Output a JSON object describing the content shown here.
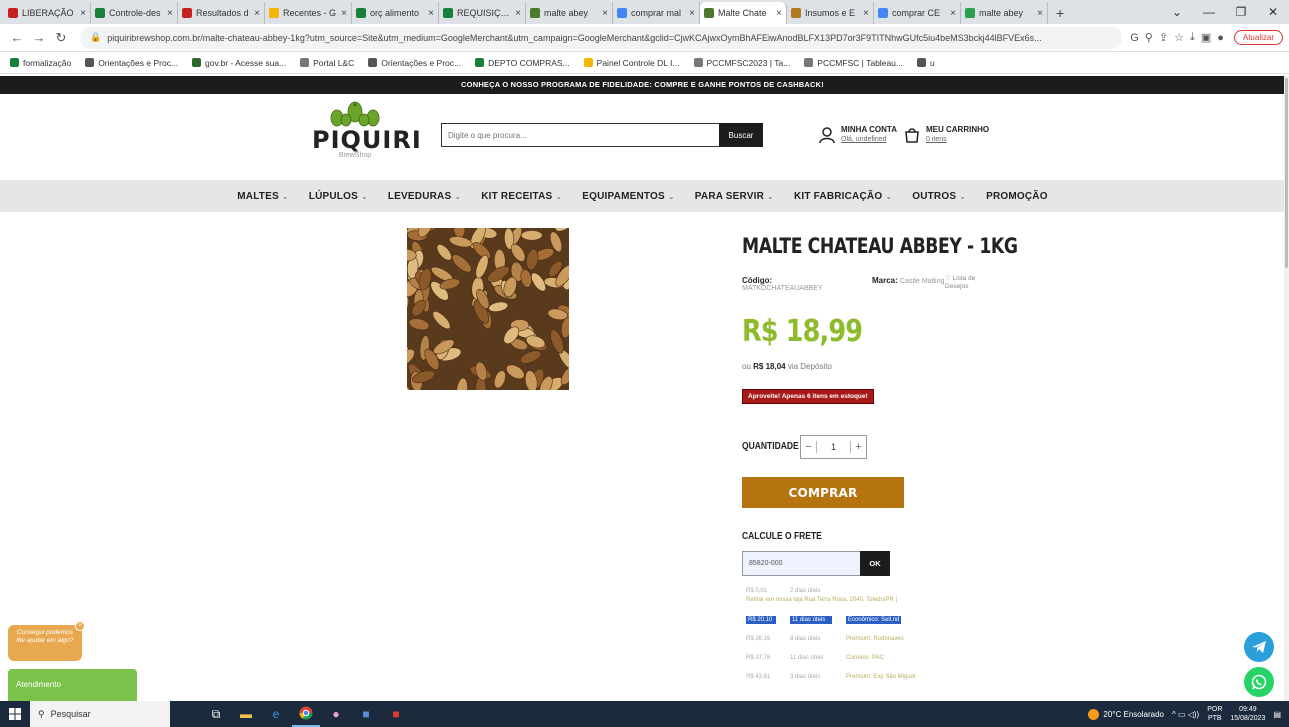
{
  "browser": {
    "tabs": [
      {
        "label": "LIBERAÇÃO",
        "icon": "gmail-icon",
        "color": "#c5221f"
      },
      {
        "label": "Controle-des",
        "icon": "sheets-icon",
        "color": "#188038"
      },
      {
        "label": "Resultados d",
        "icon": "gmail-icon",
        "color": "#c5221f"
      },
      {
        "label": "Recentes - G",
        "icon": "drive-icon",
        "color": "#f4b400"
      },
      {
        "label": "orç alimento",
        "icon": "sheets-icon",
        "color": "#188038"
      },
      {
        "label": "REQUISIÇÃO",
        "icon": "sheets-icon",
        "color": "#188038"
      },
      {
        "label": "malte abey",
        "icon": "site-icon",
        "color": "#4a7a2a"
      },
      {
        "label": "comprar mal",
        "icon": "google-icon",
        "color": "#4285f4"
      },
      {
        "label": "Malte Chate",
        "icon": "site-icon",
        "color": "#4a7a2a",
        "active": true
      },
      {
        "label": "Insumos e E",
        "icon": "site-icon",
        "color": "#b07a20"
      },
      {
        "label": "comprar CE",
        "icon": "google-icon",
        "color": "#4285f4"
      },
      {
        "label": "malte abey",
        "icon": "site-icon",
        "color": "#2aa050"
      }
    ],
    "new_tab": "+",
    "url": "piquiribrewshop.com.br/malte-chateau-abbey-1kg?utm_source=Site&utm_medium=GoogleMerchant&utm_campaign=GoogleMerchant&gclid=CjwKCAjwxOymBhAFEiwAnodBLFX13PD7or3F9TITNhwGUfc5iu4beMS3bckj44lBFVEx6s...",
    "update_label": "Atualizar",
    "bookmarks": [
      {
        "label": "formalização",
        "color": "#188038"
      },
      {
        "label": "Orientações e Proc...",
        "color": "#555"
      },
      {
        "label": "gov.br - Acesse sua...",
        "color": "#2d6a2d"
      },
      {
        "label": "Portal L&C",
        "color": "#777"
      },
      {
        "label": "Orientações e Proc...",
        "color": "#555"
      },
      {
        "label": "DEPTO COMPRAS...",
        "color": "#188038"
      },
      {
        "label": "Painel Controle DL I...",
        "color": "#f4b400"
      },
      {
        "label": "PCCMFSC2023 | Ta...",
        "color": "#777"
      },
      {
        "label": "PCCMFSC | Tableau...",
        "color": "#777"
      },
      {
        "label": "u",
        "color": "#555"
      }
    ]
  },
  "site": {
    "announcement": "CONHEÇA O NOSSO PROGRAMA DE FIDELIDADE: COMPRE E GANHE PONTOS DE CASHBACK!",
    "logo_name": "PIQUIRI",
    "logo_sub": "BrewShop",
    "search_placeholder": "Digite o que procura...",
    "search_button": "Buscar",
    "account_title": "MINHA CONTA",
    "account_sub": "Olá, undefined",
    "cart_title": "MEU CARRINHO",
    "cart_sub": "0 itens",
    "categories": [
      {
        "label": "MALTES",
        "chev": true
      },
      {
        "label": "LÚPULOS",
        "chev": true
      },
      {
        "label": "LEVEDURAS",
        "chev": true
      },
      {
        "label": "KIT RECEITAS",
        "chev": true
      },
      {
        "label": "EQUIPAMENTOS",
        "chev": true
      },
      {
        "label": "PARA SERVIR",
        "chev": true
      },
      {
        "label": "KIT FABRICAÇÃO",
        "chev": true
      },
      {
        "label": "OUTROS",
        "chev": true
      },
      {
        "label": "PROMOÇÃO",
        "chev": false
      }
    ]
  },
  "product": {
    "title": "MALTE CHATEAU ABBEY - 1KG",
    "code_label": "Código:",
    "code_value": "MATKOCHATEAUABBEY",
    "brand_label": "Marca:",
    "brand_value": "Castle Malting",
    "wishlist": "Lista de Desejos",
    "price": "R$ 18,99",
    "deposit_prefix": "ou",
    "deposit_price": "R$ 18,04",
    "deposit_suffix": "via Depósito",
    "stock_badge": "Aproveite! Apenas 6 itens em estoque!",
    "qty_label": "QUANTIDADE",
    "qty_value": "1",
    "buy_button": "COMPRAR",
    "freight_title": "CALCULE O FRETE",
    "cep_value": "85820-000",
    "cep_button": "OK",
    "shipping_first": {
      "price": "R$ 0,01",
      "days": "2 dias úteis",
      "name": "Retirar em nossa loja Rua Terra Roxa, 2040, Toledo/PR |"
    },
    "shipping": [
      {
        "price": "R$ 20,10",
        "days": "11 dias úteis",
        "name": "Econômico: Sell.nd",
        "selected": true
      },
      {
        "price": "R$ 26,16",
        "days": "8 dias úteis",
        "name": "Premium: Rodonaves",
        "selected": false
      },
      {
        "price": "R$ 27,76",
        "days": "11 dias úteis",
        "name": "Correios: PAC",
        "selected": false
      },
      {
        "price": "R$ 43,81",
        "days": "3 dias úteis",
        "name": "Premium: Exp São Miguel",
        "selected": false
      }
    ]
  },
  "widgets": {
    "chat_bubble": "Consegui podemos lhe ajudar em algo?",
    "attend": "Atendimento"
  },
  "taskbar": {
    "search": "Pesquisar",
    "weather": "20°C Ensolarado",
    "lang1": "POR",
    "lang2": "PTB",
    "time": "09:49",
    "date": "15/08/2023"
  }
}
